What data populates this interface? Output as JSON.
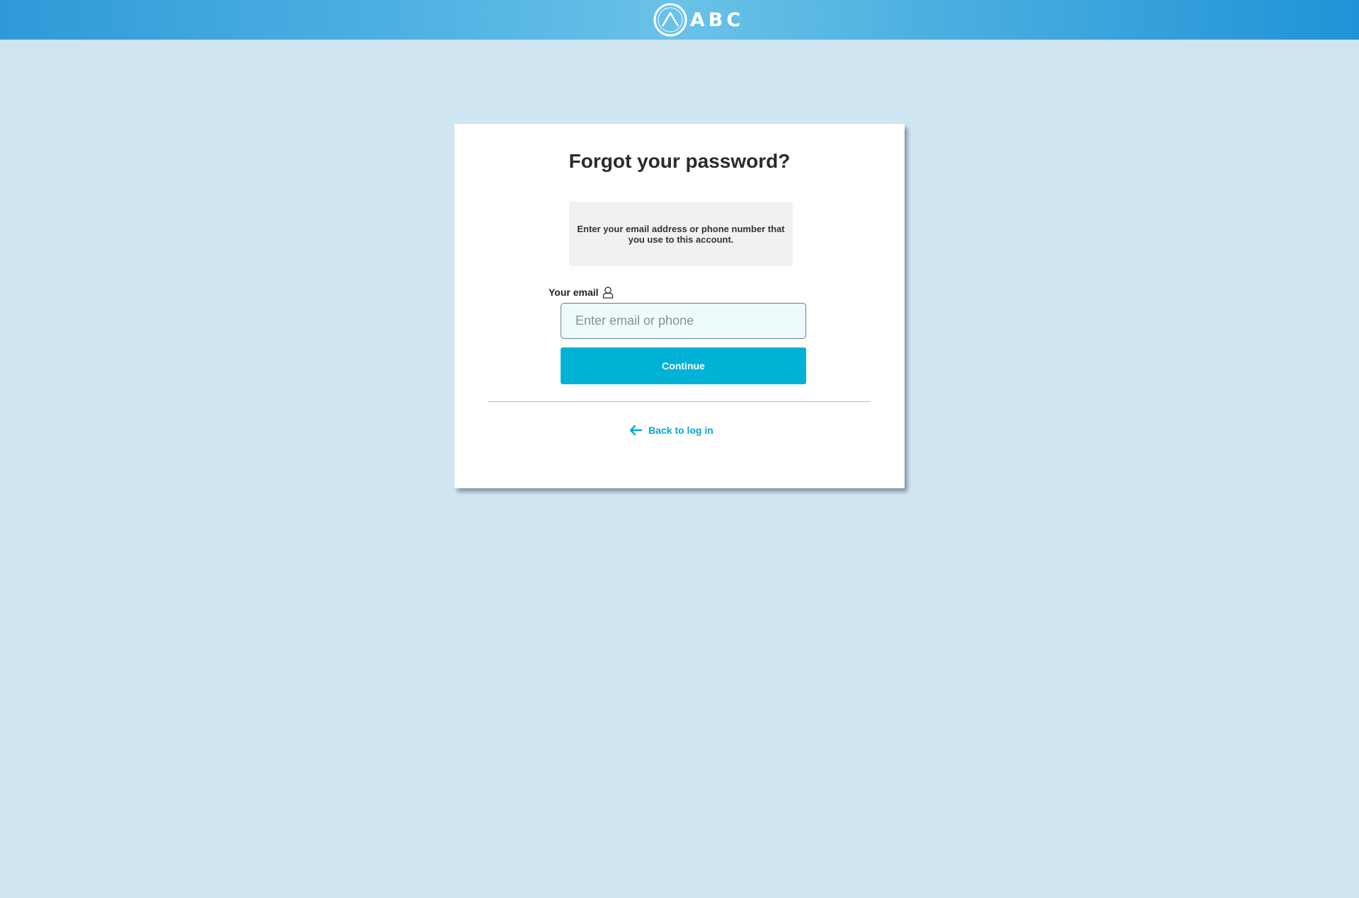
{
  "header": {
    "brand_name": "ABC",
    "logo_icon": "mountain-circle-logo",
    "colors": {
      "bar": "#2e9ad8",
      "logo": "#ffffff"
    }
  },
  "page": {
    "background": "#cfe5f1"
  },
  "card": {
    "title": "Forgot your password?",
    "instructions": "Enter your email address or phone number that you use to this account.",
    "email_field": {
      "label": "Your email",
      "label_icon": "user-icon",
      "placeholder": "Enter email or phone",
      "value": ""
    },
    "continue_label": "Continue",
    "back_link": {
      "label": "Back to log in",
      "icon": "arrow-left-icon"
    },
    "colors": {
      "accent": "#00b2d6",
      "link": "#00a9cf"
    }
  }
}
